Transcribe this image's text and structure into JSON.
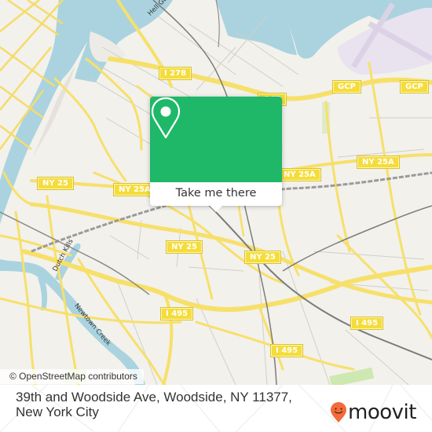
{
  "map": {
    "colors": {
      "land": "#f2f1ec",
      "water": "#aad3df",
      "road_major": "#f7e06a",
      "road_major_casing": "#e8d256",
      "road_minor": "#c9c6bd",
      "rail": "#8b8b8b",
      "park": "#cde8b0",
      "airport": "#e9e2ef"
    },
    "road_shields": [
      {
        "label": "I 278"
      },
      {
        "label": "GCP"
      },
      {
        "label": "GCP"
      },
      {
        "label": "GCP"
      },
      {
        "label": "NY 25A"
      },
      {
        "label": "NY 25A"
      },
      {
        "label": "NY 25A"
      },
      {
        "label": "NY 25"
      },
      {
        "label": "NY 25"
      },
      {
        "label": "NY 25"
      },
      {
        "label": "I 495"
      },
      {
        "label": "I 495"
      },
      {
        "label": "I 495"
      },
      {
        "label": "I 495"
      }
    ],
    "water_labels": [
      {
        "label": "Dutch Kills"
      },
      {
        "label": "Newtown Creek"
      },
      {
        "label": "Hell Gate"
      }
    ],
    "attribution": "© OpenStreetMap contributors"
  },
  "popup": {
    "icon": "location-pin-icon",
    "button_label": "Take me there",
    "accent": "#1eb868"
  },
  "footer": {
    "address": "39th and Woodside Ave, Woodside, NY 11377, New York City",
    "brand": "moovit",
    "brand_color": "#f26b3a"
  }
}
